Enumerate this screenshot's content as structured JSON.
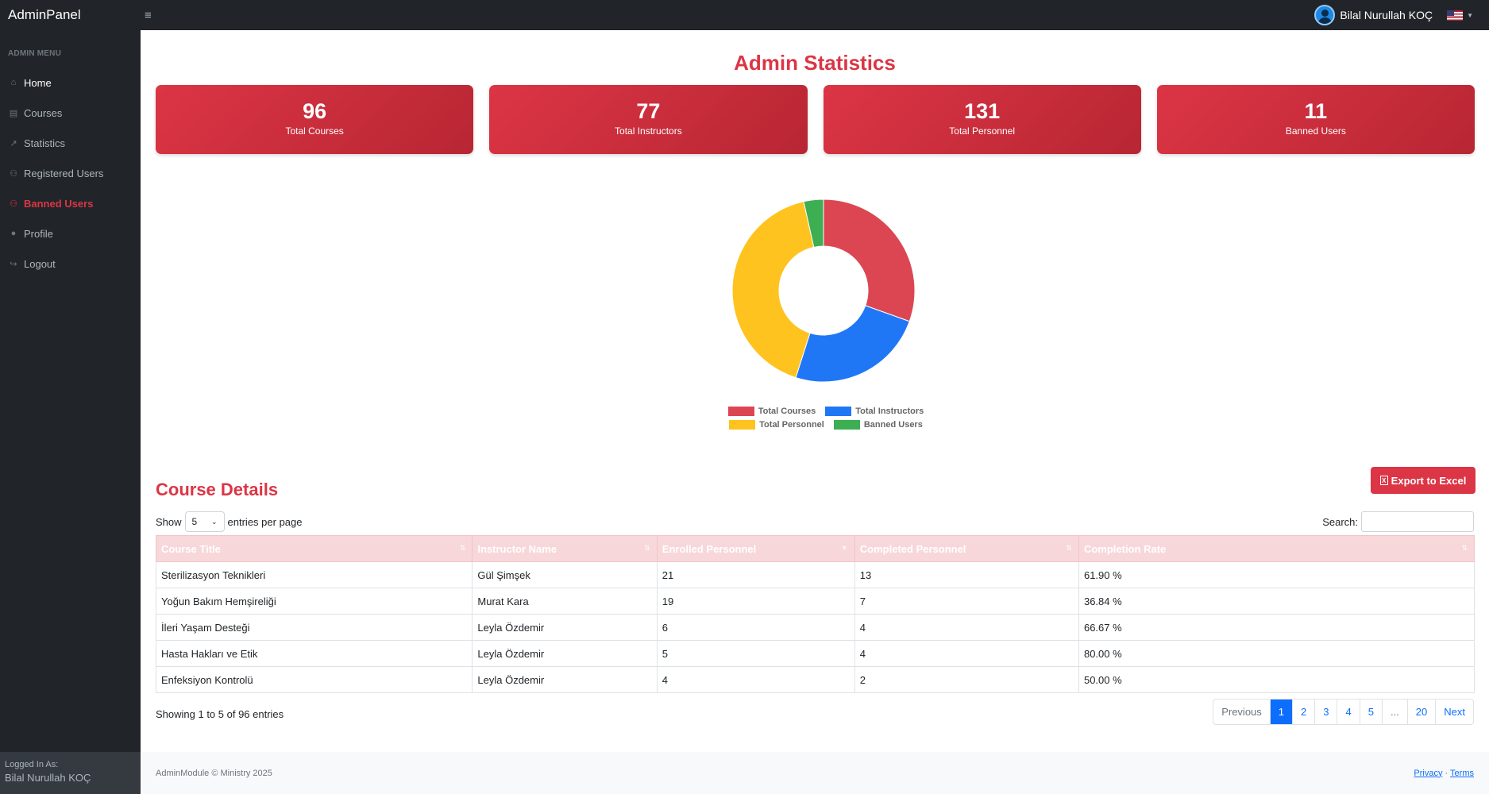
{
  "app": {
    "brand": "AdminPanel",
    "toggle_icon": "≡"
  },
  "user": {
    "name": "Bilal Nurullah KOÇ"
  },
  "sidebar": {
    "heading": "ADMIN MENU",
    "items": [
      {
        "label": "Home",
        "icon": "home-icon"
      },
      {
        "label": "Courses",
        "icon": "book-icon"
      },
      {
        "label": "Statistics",
        "icon": "chart-line-icon"
      },
      {
        "label": "Registered Users",
        "icon": "users-icon"
      },
      {
        "label": "Banned Users",
        "icon": "users-slash-icon"
      },
      {
        "label": "Profile",
        "icon": "user-icon"
      },
      {
        "label": "Logout",
        "icon": "logout-icon"
      }
    ],
    "footer_label": "Logged In As:",
    "footer_user": "Bilal Nurullah KOÇ"
  },
  "main": {
    "title": "Admin Statistics",
    "cards": [
      {
        "value": "96",
        "label": "Total Courses"
      },
      {
        "value": "77",
        "label": "Total Instructors"
      },
      {
        "value": "131",
        "label": "Total Personnel"
      },
      {
        "value": "11",
        "label": "Banned Users"
      }
    ],
    "export_label": "Export to Excel",
    "section_title": "Course Details",
    "show_label": "Show",
    "entries_value": "5",
    "entries_suffix": "entries per page",
    "search_label": "Search:",
    "search_value": "",
    "table": {
      "headers": [
        "Course Title",
        "Instructor Name",
        "Enrolled Personnel",
        "Completed Personnel",
        "Completion Rate"
      ],
      "rows": [
        [
          "Sterilizasyon Teknikleri",
          "Gül Şimşek",
          "21",
          "13",
          "61.90 %"
        ],
        [
          "Yoğun Bakım Hemşireliği",
          "Murat Kara",
          "19",
          "7",
          "36.84 %"
        ],
        [
          "İleri Yaşam Desteği",
          "Leyla Özdemir",
          "6",
          "4",
          "66.67 %"
        ],
        [
          "Hasta Hakları ve Etik",
          "Leyla Özdemir",
          "5",
          "4",
          "80.00 %"
        ],
        [
          "Enfeksiyon Kontrolü",
          "Leyla Özdemir",
          "4",
          "2",
          "50.00 %"
        ]
      ]
    },
    "showing": "Showing 1 to 5 of 96 entries",
    "pagination": [
      "Previous",
      "1",
      "2",
      "3",
      "4",
      "5",
      "...",
      "20",
      "Next"
    ]
  },
  "footer": {
    "copyright": "AdminModule © Ministry 2025",
    "privacy": "Privacy",
    "separator": " · ",
    "terms": "Terms"
  },
  "colors": {
    "accent": "#dc3545",
    "blue": "#1f77f6",
    "yellow": "#ffc31f",
    "green": "#3dae52"
  },
  "chart_data": {
    "type": "pie",
    "variant": "doughnut",
    "categories": [
      "Total Courses",
      "Total Instructors",
      "Total Personnel",
      "Banned Users"
    ],
    "values": [
      96,
      77,
      131,
      11
    ],
    "colors": [
      "#dc4653",
      "#1f77f6",
      "#ffc31f",
      "#3dae52"
    ],
    "legend_position": "bottom"
  }
}
